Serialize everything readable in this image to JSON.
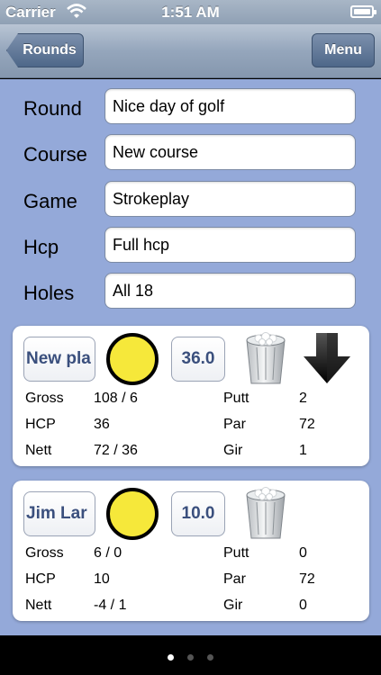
{
  "status_bar": {
    "carrier": "Carrier",
    "time": "1:51 AM"
  },
  "nav": {
    "back_label": "Rounds",
    "menu_label": "Menu"
  },
  "form": {
    "round_label": "Round",
    "round_value": "Nice day of golf",
    "course_label": "Course",
    "course_value": "New course",
    "game_label": "Game",
    "game_value": "Strokeplay",
    "hcp_label": "Hcp",
    "hcp_value": "Full hcp",
    "holes_label": "Holes",
    "holes_value": "All 18"
  },
  "players": [
    {
      "name": "New pla",
      "hcp_button": "36.0",
      "ball_color": "#f6e83a",
      "gross_label": "Gross",
      "gross": "108 / 6",
      "hcp_label": "HCP",
      "hcp": "36",
      "nett_label": "Nett",
      "nett": "72 / 36",
      "putt_label": "Putt",
      "putt": "2",
      "par_label": "Par",
      "par": "72",
      "gir_label": "Gir",
      "gir": "1"
    },
    {
      "name": "Jim Lar",
      "hcp_button": "10.0",
      "ball_color": "#f6e83a",
      "gross_label": "Gross",
      "gross": "6 / 0",
      "hcp_label": "HCP",
      "hcp": "10",
      "nett_label": "Nett",
      "nett": "-4 / 1",
      "putt_label": "Putt",
      "putt": "0",
      "par_label": "Par",
      "par": "72",
      "gir_label": "Gir",
      "gir": "0"
    }
  ],
  "page_control": {
    "pages": 3,
    "current": 1
  }
}
